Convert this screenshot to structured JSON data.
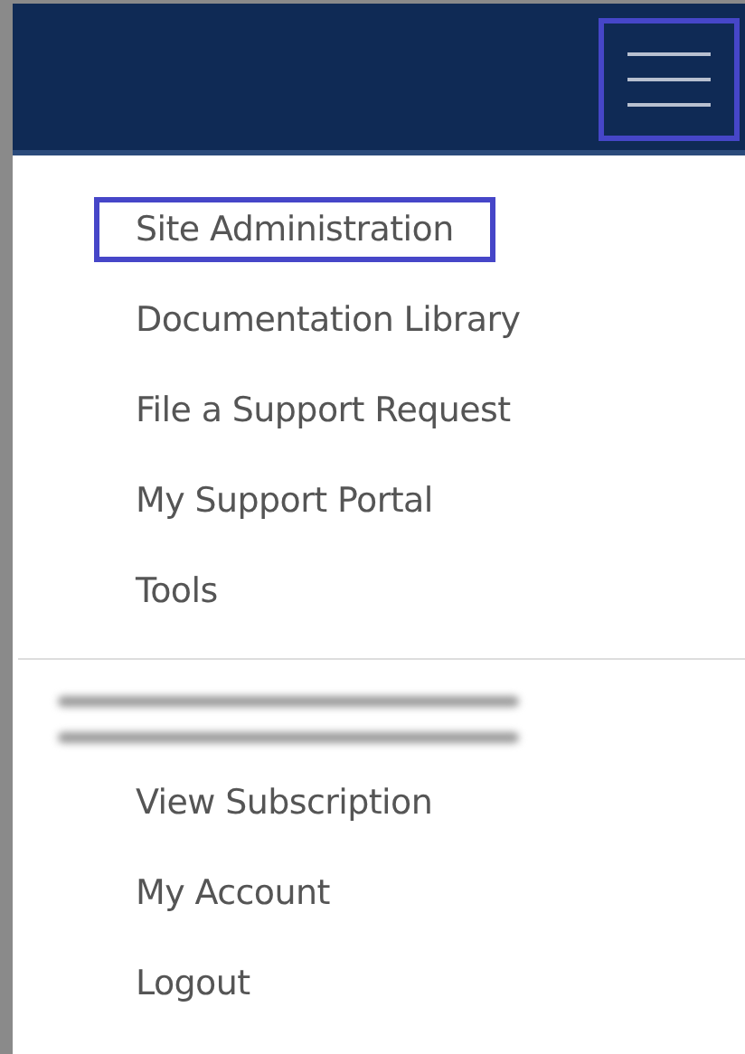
{
  "header": {
    "menu_button": {
      "highlighted": true
    }
  },
  "menu": {
    "sections": [
      {
        "items": [
          {
            "label": "Site Administration",
            "highlighted": true
          },
          {
            "label": "Documentation Library",
            "highlighted": false
          },
          {
            "label": "File a Support Request",
            "highlighted": false
          },
          {
            "label": "My Support Portal",
            "highlighted": false
          },
          {
            "label": "Tools",
            "highlighted": false
          }
        ]
      },
      {
        "redacted_text": true,
        "items": [
          {
            "label": "View Subscription",
            "highlighted": false
          },
          {
            "label": "My Account",
            "highlighted": false
          },
          {
            "label": "Logout",
            "highlighted": false
          }
        ]
      }
    ]
  }
}
